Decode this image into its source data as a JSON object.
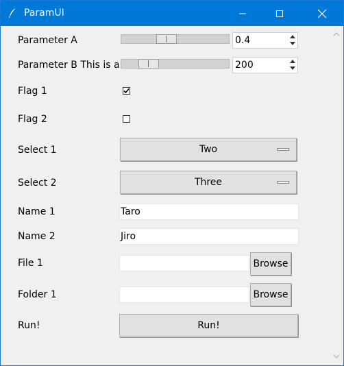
{
  "window": {
    "title": "ParamUI",
    "accent": "#0078d7",
    "icons": [
      "feather-icon",
      "minimize-icon",
      "maximize-icon",
      "close-icon"
    ]
  },
  "params": {
    "param_a": {
      "label": "Parameter A",
      "value": "0.4",
      "slider_fraction": 0.4
    },
    "param_b": {
      "label": "Parameter B This is a p",
      "value": "200",
      "slider_fraction": 0.2
    },
    "flag1": {
      "label": "Flag 1",
      "checked": true
    },
    "flag2": {
      "label": "Flag 2",
      "checked": false
    },
    "select1": {
      "label": "Select 1",
      "value": "Two"
    },
    "select2": {
      "label": "Select 2",
      "value": "Three"
    },
    "name1": {
      "label": "Name 1",
      "value": "Taro"
    },
    "name2": {
      "label": "Name 2",
      "value": "Jiro"
    },
    "file1": {
      "label": "File 1",
      "value": "",
      "button": "Browse"
    },
    "folder1": {
      "label": "Folder 1",
      "value": "",
      "button": "Browse"
    },
    "run": {
      "label": "Run!",
      "button": "Run!"
    }
  }
}
